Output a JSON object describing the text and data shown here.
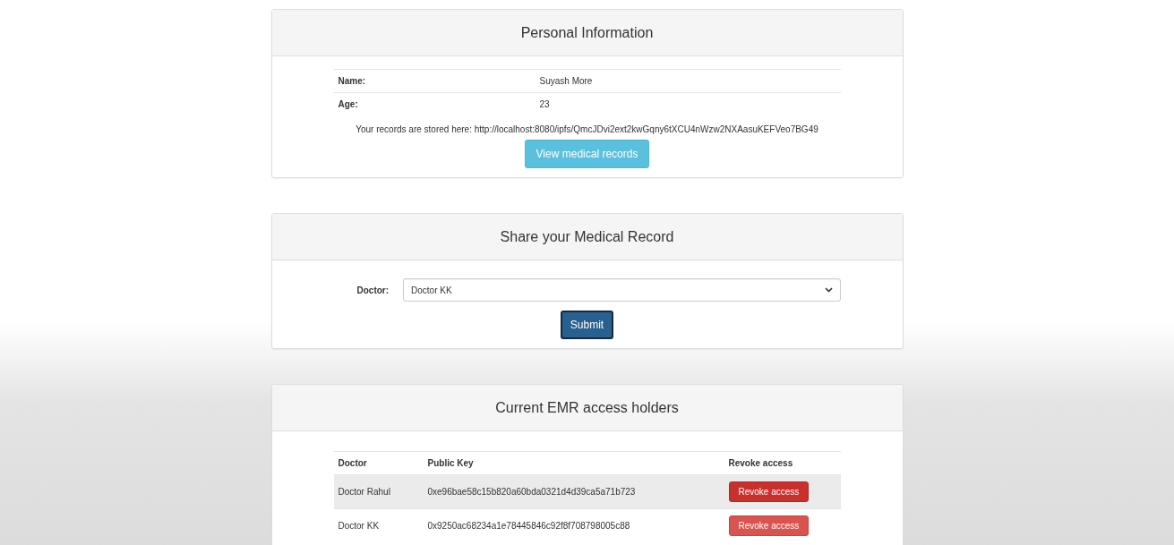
{
  "personal": {
    "title": "Personal Information",
    "fields": [
      {
        "label": "Name:",
        "value": "Suyash More"
      },
      {
        "label": "Age:",
        "value": "23"
      }
    ],
    "records_text": "Your records are stored here: http://localhost:8080/ipfs/QmcJDvi2ext2kwGqny6tXCU4nWzw2NXAasuKEFVeo7BG49",
    "view_button": "View medical records"
  },
  "share": {
    "title": "Share your Medical Record",
    "doctor_label": "Doctor:",
    "doctor_value": "Doctor KK",
    "submit": "Submit"
  },
  "access": {
    "title": "Current EMR access holders",
    "columns": [
      "Doctor",
      "Public Key",
      "Revoke access"
    ],
    "rows": [
      {
        "doctor": "Doctor Rahul",
        "key": "0xe96bae58c15b820a60bda0321d4d39ca5a71b723",
        "button": "Revoke access",
        "hovered": true
      },
      {
        "doctor": "Doctor KK",
        "key": "0x9250ac68234a1e78445846c92f8f708798005c88",
        "button": "Revoke access",
        "hovered": false
      }
    ]
  }
}
